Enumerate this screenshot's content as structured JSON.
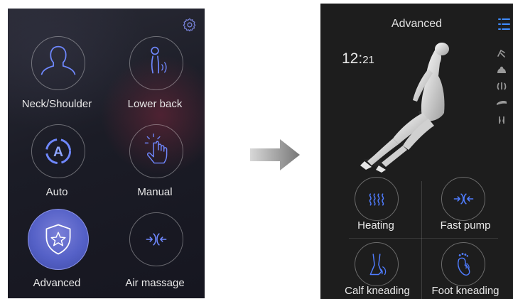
{
  "left_screen": {
    "tiles": [
      {
        "label": "Neck/Shoulder",
        "icon": "neck-shoulder-icon"
      },
      {
        "label": "Lower back",
        "icon": "lower-back-icon"
      },
      {
        "label": "Auto",
        "icon": "auto-icon"
      },
      {
        "label": "Manual",
        "icon": "manual-icon"
      },
      {
        "label": "Advanced",
        "icon": "advanced-shield-icon",
        "active": true
      },
      {
        "label": "Air massage",
        "icon": "air-massage-icon"
      }
    ],
    "settings_icon": "gear-icon",
    "accent": "#5a65c9"
  },
  "transition_arrow": "arrow-right-icon",
  "right_screen": {
    "title": "Advanced",
    "time_hours": "12",
    "time_sep": ":",
    "time_minutes": "21",
    "menu_icon": "list-icon",
    "side_icons": [
      "recline-icon",
      "shoulder-icon",
      "back-icon",
      "seat-icon",
      "leg-icon"
    ],
    "tiles": [
      {
        "label": "Heating",
        "icon": "heat-waves-icon"
      },
      {
        "label": "Fast pump",
        "icon": "air-pump-icon"
      },
      {
        "label": "Calf kneading",
        "icon": "calf-icon"
      },
      {
        "label": "Foot kneading",
        "icon": "foot-icon"
      }
    ],
    "accent": "#4f6fd1"
  }
}
